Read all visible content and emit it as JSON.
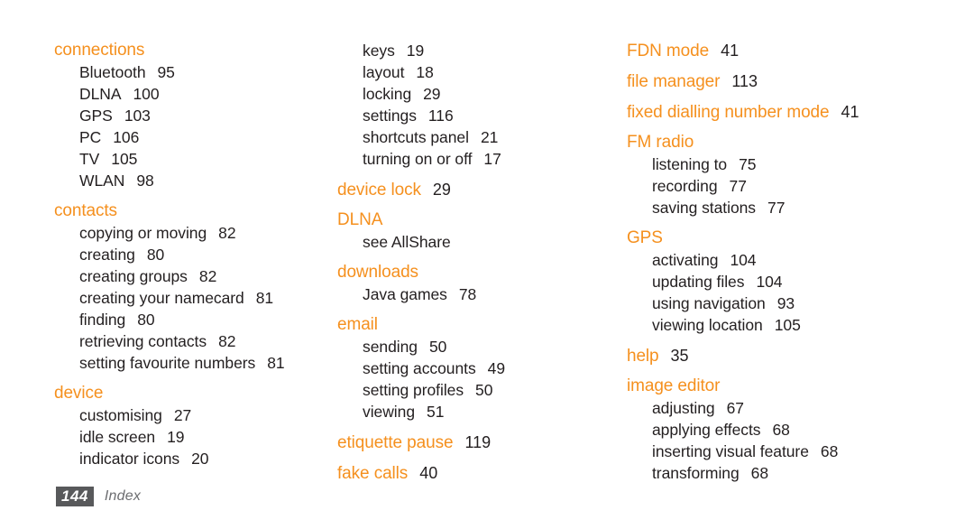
{
  "footer": {
    "page_number": "144",
    "label": "Index"
  },
  "colors": {
    "heading": "#F5901E",
    "body": "#231f20",
    "badge_background": "#58595B",
    "footer_label": "#6D6E71"
  },
  "columns": [
    {
      "groups": [
        {
          "heading": "connections",
          "heading_page": "",
          "entries": [
            {
              "label": "Bluetooth",
              "page": "95"
            },
            {
              "label": "DLNA",
              "page": "100"
            },
            {
              "label": "GPS",
              "page": "103"
            },
            {
              "label": "PC",
              "page": "106"
            },
            {
              "label": "TV",
              "page": "105"
            },
            {
              "label": "WLAN",
              "page": "98"
            }
          ]
        },
        {
          "heading": "contacts",
          "heading_page": "",
          "entries": [
            {
              "label": "copying or moving",
              "page": "82"
            },
            {
              "label": "creating",
              "page": "80"
            },
            {
              "label": "creating groups",
              "page": "82"
            },
            {
              "label": "creating your namecard",
              "page": "81"
            },
            {
              "label": "finding",
              "page": "80"
            },
            {
              "label": "retrieving contacts",
              "page": "82"
            },
            {
              "label": "setting favourite numbers",
              "page": "81"
            }
          ]
        },
        {
          "heading": "device",
          "heading_page": "",
          "entries": [
            {
              "label": "customising",
              "page": "27"
            },
            {
              "label": "idle screen",
              "page": "19"
            },
            {
              "label": "indicator icons",
              "page": "20"
            }
          ]
        }
      ]
    },
    {
      "groups": [
        {
          "heading": "",
          "heading_page": "",
          "entries": [
            {
              "label": "keys",
              "page": "19"
            },
            {
              "label": "layout",
              "page": "18"
            },
            {
              "label": "locking",
              "page": "29"
            },
            {
              "label": "settings",
              "page": "116"
            },
            {
              "label": "shortcuts panel",
              "page": "21"
            },
            {
              "label": "turning on or off",
              "page": "17"
            }
          ]
        },
        {
          "heading": "device lock",
          "heading_page": "29",
          "entries": []
        },
        {
          "heading": "DLNA",
          "heading_page": "",
          "entries": [
            {
              "label": "see AllShare",
              "page": ""
            }
          ]
        },
        {
          "heading": "downloads",
          "heading_page": "",
          "entries": [
            {
              "label": "Java games",
              "page": "78"
            }
          ]
        },
        {
          "heading": "email",
          "heading_page": "",
          "entries": [
            {
              "label": "sending",
              "page": "50"
            },
            {
              "label": "setting accounts",
              "page": "49"
            },
            {
              "label": "setting profiles",
              "page": "50"
            },
            {
              "label": "viewing",
              "page": "51"
            }
          ]
        },
        {
          "heading": "etiquette pause",
          "heading_page": "119",
          "entries": []
        },
        {
          "heading": "fake calls",
          "heading_page": "40",
          "entries": []
        }
      ]
    },
    {
      "groups": [
        {
          "heading": "FDN mode",
          "heading_page": "41",
          "entries": []
        },
        {
          "heading": "file manager",
          "heading_page": "113",
          "entries": []
        },
        {
          "heading": "fixed dialling number mode",
          "heading_page": "41",
          "entries": []
        },
        {
          "heading": "FM radio",
          "heading_page": "",
          "entries": [
            {
              "label": "listening to",
              "page": "75"
            },
            {
              "label": "recording",
              "page": "77"
            },
            {
              "label": "saving stations",
              "page": "77"
            }
          ]
        },
        {
          "heading": "GPS",
          "heading_page": "",
          "entries": [
            {
              "label": "activating",
              "page": "104"
            },
            {
              "label": "updating files",
              "page": "104"
            },
            {
              "label": "using navigation",
              "page": "93"
            },
            {
              "label": "viewing location",
              "page": "105"
            }
          ]
        },
        {
          "heading": "help",
          "heading_page": "35",
          "entries": []
        },
        {
          "heading": "image editor",
          "heading_page": "",
          "entries": [
            {
              "label": "adjusting",
              "page": "67"
            },
            {
              "label": "applying effects",
              "page": "68"
            },
            {
              "label": "inserting visual feature",
              "page": "68"
            },
            {
              "label": "transforming",
              "page": "68"
            }
          ]
        }
      ]
    }
  ]
}
